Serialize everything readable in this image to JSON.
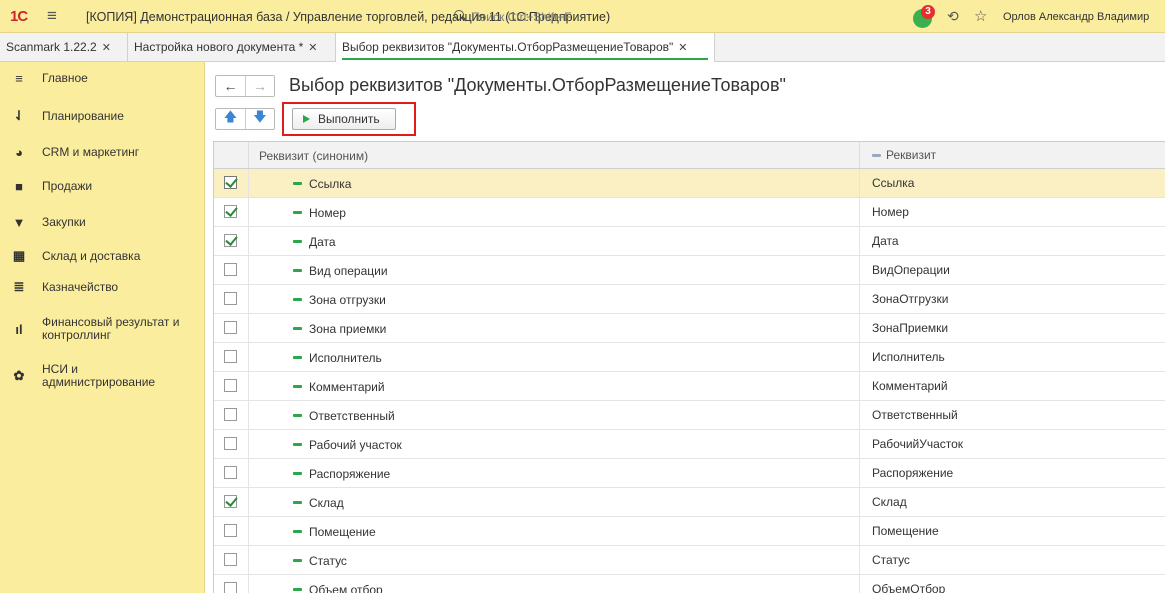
{
  "topbar": {
    "logo": "1С",
    "app_title": "[КОПИЯ] Демонстрационная база / Управление торговлей, редакция 11  (1С:Предприятие)",
    "search_placeholder": "Поиск Ctrl+Shift+F",
    "notifications_count": "3",
    "user_name": "Орлов Александр Владимир"
  },
  "tabs": [
    {
      "label": "Scanmark 1.22.2"
    },
    {
      "label": "Настройка нового документа *"
    },
    {
      "label": "Выбор реквизитов \"Документы.ОтборРазмещениеТоваров\""
    }
  ],
  "sidebar": {
    "items": [
      {
        "label": "Главное",
        "icon": "menu-lines-icon"
      },
      {
        "label": "Планирование",
        "icon": "planning-icon"
      },
      {
        "label": "CRM и маркетинг",
        "icon": "crm-icon"
      },
      {
        "label": "Продажи",
        "icon": "sales-bag-icon"
      },
      {
        "label": "Закупки",
        "icon": "cart-icon"
      },
      {
        "label": "Склад и доставка",
        "icon": "warehouse-icon"
      },
      {
        "label": "Казначейство",
        "icon": "treasury-icon"
      },
      {
        "label": "Финансовый результат и контроллинг",
        "icon": "finance-chart-icon"
      },
      {
        "label": "НСИ и администрирование",
        "icon": "gear-icon"
      }
    ]
  },
  "form": {
    "title": "Выбор реквизитов \"Документы.ОтборРазмещениеТоваров\"",
    "run_label": "Выполнить"
  },
  "grid": {
    "col_synonym": "Реквизит (синоним)",
    "col_name": "Реквизит",
    "rows": [
      {
        "synonym": "Ссылка",
        "name": "Ссылка",
        "checked": true,
        "selected": true
      },
      {
        "synonym": "Номер",
        "name": "Номер",
        "checked": true
      },
      {
        "synonym": "Дата",
        "name": "Дата",
        "checked": true
      },
      {
        "synonym": "Вид операции",
        "name": "ВидОперации",
        "checked": false
      },
      {
        "synonym": "Зона отгрузки",
        "name": "ЗонаОтгрузки",
        "checked": false
      },
      {
        "synonym": "Зона приемки",
        "name": "ЗонаПриемки",
        "checked": false
      },
      {
        "synonym": "Исполнитель",
        "name": "Исполнитель",
        "checked": false
      },
      {
        "synonym": "Комментарий",
        "name": "Комментарий",
        "checked": false
      },
      {
        "synonym": "Ответственный",
        "name": "Ответственный",
        "checked": false
      },
      {
        "synonym": "Рабочий участок",
        "name": "РабочийУчасток",
        "checked": false
      },
      {
        "synonym": "Распоряжение",
        "name": "Распоряжение",
        "checked": false
      },
      {
        "synonym": "Склад",
        "name": "Склад",
        "checked": true
      },
      {
        "synonym": "Помещение",
        "name": "Помещение",
        "checked": false
      },
      {
        "synonym": "Статус",
        "name": "Статус",
        "checked": false
      },
      {
        "synonym": "Объем отбор",
        "name": "ОбъемОтбор",
        "checked": false
      }
    ]
  },
  "colors": {
    "panel_yellow": "#fbed9e",
    "accent_green": "#2aa748",
    "highlight_red": "#e01b1b",
    "selected_row": "#fbf0c4"
  }
}
